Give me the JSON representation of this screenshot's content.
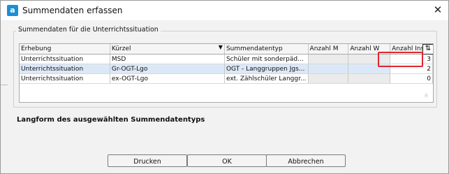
{
  "window": {
    "title": "Summendaten erfassen",
    "close_symbol": "✕"
  },
  "group": {
    "legend": "Summendaten für die Unterrichtssituation"
  },
  "grid": {
    "columns": [
      "Erhebung",
      "Kürzel",
      "Summendatentyp",
      "Anzahl M",
      "Anzahl W",
      "Anzahl Ins."
    ],
    "rows": [
      {
        "erhebung": "Unterrichtssituation",
        "kuerzel": "MSD",
        "typ": "Schüler mit sonderpäd...",
        "anzahl_m": "",
        "anzahl_w": "",
        "anzahl_ins": "3"
      },
      {
        "erhebung": "Unterrichtssituation",
        "kuerzel": "Gr-OGT-Lgo",
        "typ": "OGT - Langgruppen Jgs...",
        "anzahl_m": "",
        "anzahl_w": "",
        "anzahl_ins": "2"
      },
      {
        "erhebung": "Unterrichtssituation",
        "kuerzel": "ex-OGT-Lgo",
        "typ": "ext. Zählschüler Langgr...",
        "anzahl_m": "",
        "anzahl_w": "",
        "anzahl_ins": "0"
      }
    ],
    "sort_symbol": "▼",
    "column_chooser_symbol": "⇅",
    "scroll_symbol": "≚"
  },
  "langform": {
    "label": "Langform des ausgewählten Summendatentyps"
  },
  "buttons": {
    "print": "Drucken",
    "ok": "OK",
    "cancel": "Abbrechen"
  },
  "colors": {
    "selection": "#dbe8f7",
    "highlight": "#e0262e",
    "accent": "#1b8fd6"
  }
}
